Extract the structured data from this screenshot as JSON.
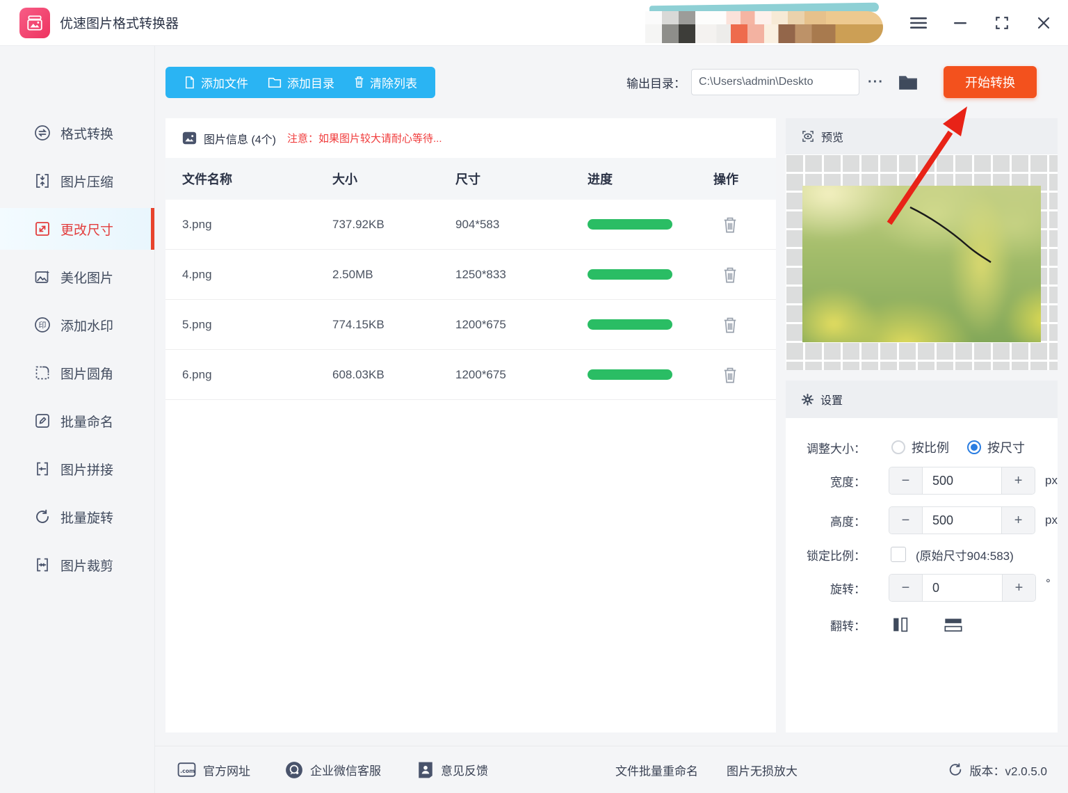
{
  "titlebar": {
    "app_title": "优速图片格式转换器"
  },
  "toolbar": {
    "add_file": "添加文件",
    "add_dir": "添加目录",
    "clear_list": "清除列表",
    "output_label": "输出目录：",
    "output_path": "C:\\Users\\admin\\Deskto",
    "more_label": "···",
    "start_label": "开始转换"
  },
  "sidebar": {
    "items": [
      {
        "label": "格式转换",
        "active": false
      },
      {
        "label": "图片压缩",
        "active": false
      },
      {
        "label": "更改尺寸",
        "active": true
      },
      {
        "label": "美化图片",
        "active": false
      },
      {
        "label": "添加水印",
        "active": false
      },
      {
        "label": "图片圆角",
        "active": false
      },
      {
        "label": "批量命名",
        "active": false
      },
      {
        "label": "图片拼接",
        "active": false
      },
      {
        "label": "批量旋转",
        "active": false
      },
      {
        "label": "图片裁剪",
        "active": false
      }
    ]
  },
  "table": {
    "info_title": "图片信息 (4个)",
    "notice": "注意：如果图片较大请耐心等待...",
    "headers": [
      "文件名称",
      "大小",
      "尺寸",
      "进度",
      "操作"
    ],
    "rows": [
      {
        "name": "3.png",
        "size": "737.92KB",
        "dims": "904*583",
        "progress": 100
      },
      {
        "name": "4.png",
        "size": "2.50MB",
        "dims": "1250*833",
        "progress": 100
      },
      {
        "name": "5.png",
        "size": "774.15KB",
        "dims": "1200*675",
        "progress": 100
      },
      {
        "name": "6.png",
        "size": "608.03KB",
        "dims": "1200*675",
        "progress": 100
      }
    ]
  },
  "preview": {
    "title": "预览"
  },
  "settings": {
    "title": "设置",
    "resize_label": "调整大小：",
    "radio_options": [
      {
        "label": "按比例",
        "selected": false
      },
      {
        "label": "按尺寸",
        "selected": true
      }
    ],
    "width_label": "宽度：",
    "width_value": "500",
    "width_unit": "px",
    "height_label": "高度：",
    "height_value": "500",
    "height_unit": "px",
    "lock_label": "锁定比例：",
    "lock_checked": false,
    "lock_hint": "(原始尺寸904:583)",
    "rotate_label": "旋转：",
    "rotate_value": "0",
    "rotate_unit": "°",
    "flip_label": "翻转：",
    "minus": "−",
    "plus": "+"
  },
  "footer": {
    "links": [
      "官方网址",
      "企业微信客服",
      "意见反馈"
    ],
    "mid_links": [
      "文件批量重命名",
      "图片无损放大"
    ],
    "version_label": "版本：v2.0.5.0"
  },
  "icons": {
    "app-logo": "stacked-photos",
    "menu": "hamburger",
    "minimize": "−",
    "maximize": "fullscreen-corners",
    "close": "✕",
    "add-file": "document",
    "add-dir": "folder",
    "clear-list": "trash",
    "browse-folder": "folder-filled",
    "image-info": "image",
    "preview": "eye-scan",
    "settings": "gear",
    "delete-row": "trash-outline",
    "flip-horizontal": "bars-vertical",
    "flip-vertical": "bars-horizontal",
    "website": ".com-window",
    "wechat-service": "chat-circle",
    "feedback": "doc-person",
    "version": "refresh"
  },
  "colors": {
    "toolbar_blue": "#2ab4f3",
    "start_orange": "#f3511d",
    "progress_green": "#2abd64",
    "active_red": "#e23c3c",
    "radio_blue": "#2a7de1",
    "notice_red": "#f03b3b",
    "text_dark": "#2b3346",
    "annotation_red": "#e82317"
  }
}
